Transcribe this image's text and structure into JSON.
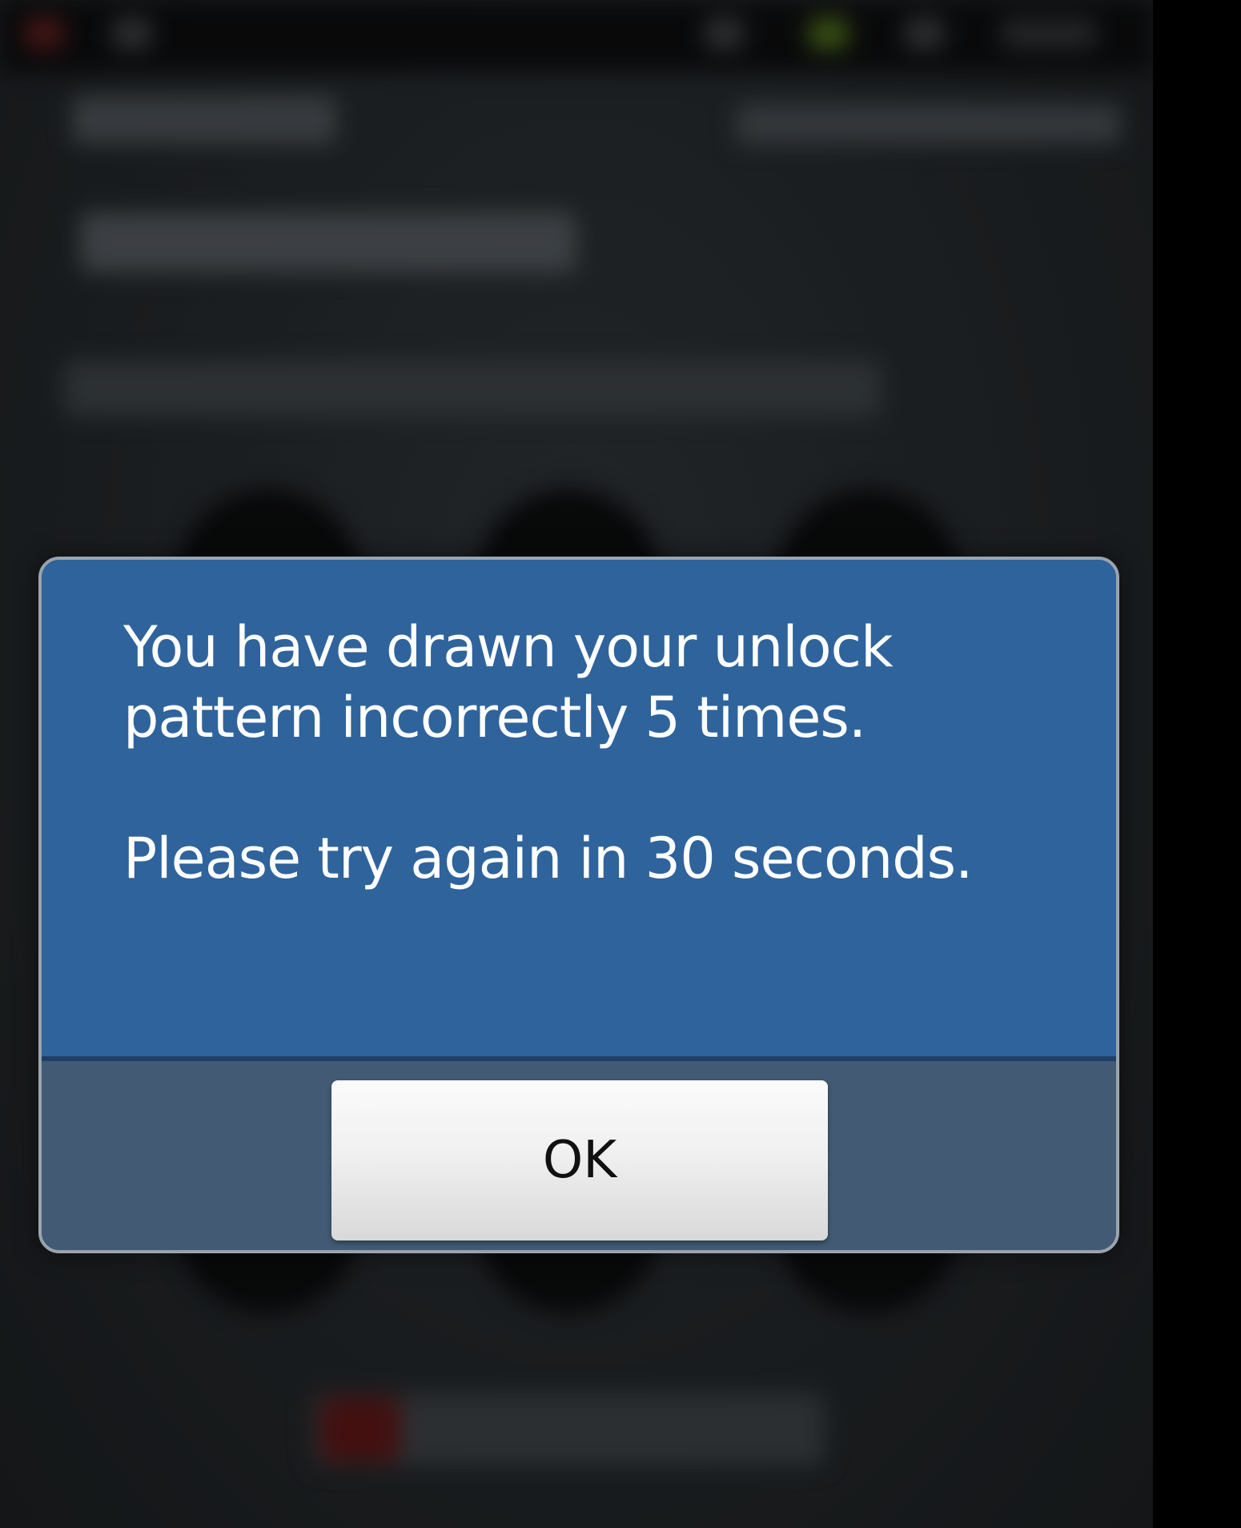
{
  "dialog": {
    "message_line1": "You have drawn your unlock pattern incorrectly 5 times.",
    "message_line2": "Please try again in 30 seconds.",
    "ok_label": "OK"
  },
  "colors": {
    "dialog_blue": "#2f639c",
    "footer_blue_gray": "#425a73",
    "button_bg": "#f0f0f0",
    "background_dark": "#23272a"
  }
}
